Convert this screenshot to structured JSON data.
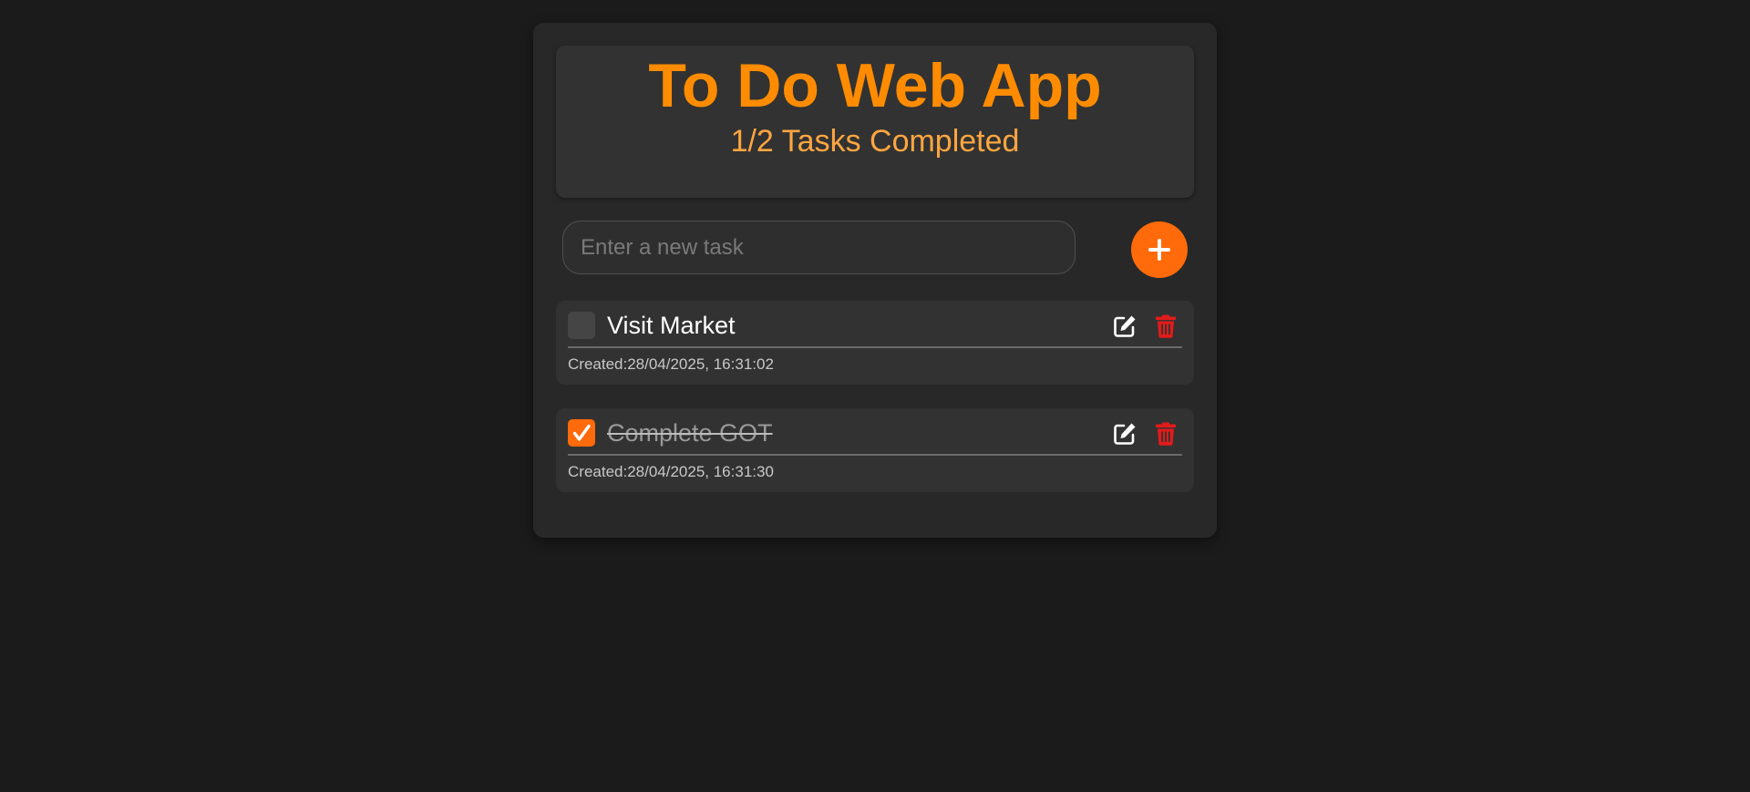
{
  "header": {
    "title": "To Do Web App",
    "progress": "1/2 Tasks Completed",
    "completed_count": 1,
    "total_count": 2
  },
  "input": {
    "placeholder": "Enter a new task",
    "value": ""
  },
  "add_button": {
    "icon": "plus-icon"
  },
  "tasks": [
    {
      "text": "Visit Market",
      "completed": false,
      "created": "Created:28/04/2025, 16:31:02"
    },
    {
      "text": "Complete GOT",
      "completed": true,
      "created": "Created:28/04/2025, 16:31:30"
    }
  ],
  "icons": {
    "edit": "edit-icon",
    "delete": "trash-icon",
    "check": "checkmark-icon"
  },
  "colors": {
    "accent": "#ff6a0a",
    "title": "#ff8c00",
    "subtitle": "#ffa640",
    "delete": "#e31b1b",
    "background": "#1b1b1b",
    "card": "#282828",
    "panel": "#323232"
  }
}
